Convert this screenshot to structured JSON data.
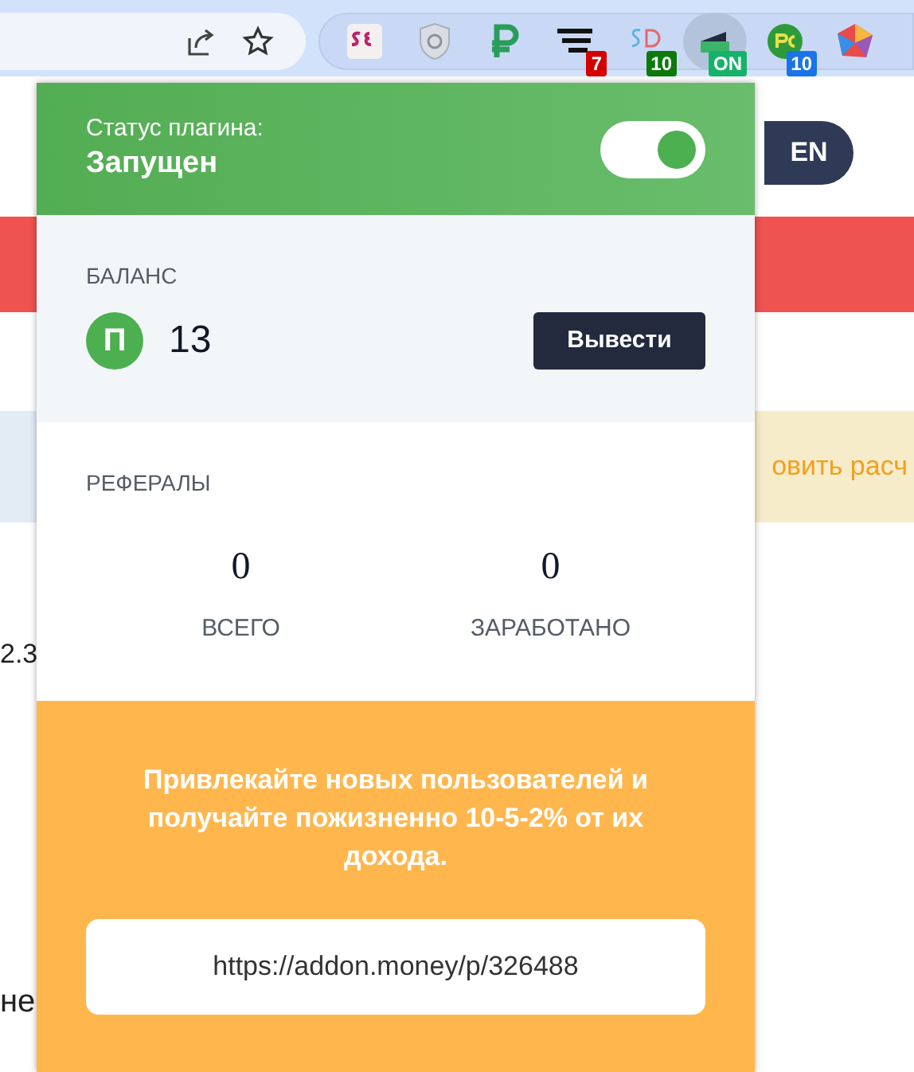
{
  "toolbar": {
    "extensions": [
      {
        "kind": "se",
        "selected": false
      },
      {
        "kind": "shield",
        "selected": false
      },
      {
        "kind": "ruble",
        "selected": false
      },
      {
        "kind": "lines",
        "badge": {
          "text": "7",
          "color": "#d50000"
        },
        "selected": false
      },
      {
        "kind": "sd",
        "badge": {
          "text": "10",
          "color": "#0b7a0b"
        },
        "selected": false
      },
      {
        "kind": "addon",
        "badge": {
          "text": "ON",
          "color": "#17b26a"
        },
        "selected": true
      },
      {
        "kind": "pc",
        "badge": {
          "text": "10",
          "color": "#1a73e8"
        },
        "selected": false
      },
      {
        "kind": "cube",
        "selected": false
      }
    ]
  },
  "background_page": {
    "language_button": "EN",
    "banner_text": "овить расч",
    "left_fragments": [
      "2.3",
      "не"
    ]
  },
  "popup": {
    "status_label": "Статус плагина:",
    "status_value": "Запущен",
    "enabled": true,
    "balance": {
      "title": "БАЛАНС",
      "currency_symbol": "П",
      "amount": "13",
      "withdraw_button": "Вывести"
    },
    "referrals": {
      "title": "РЕФЕРАЛЫ",
      "stats": [
        {
          "value": "0",
          "label": "ВСЕГО"
        },
        {
          "value": "0",
          "label": "ЗАРАБОТАНО"
        }
      ]
    },
    "promo": {
      "text": "Привлекайте новых пользователей и получайте пожизненно 10-5-2% от их дохода.",
      "link": "https://addon.money/p/326488"
    }
  }
}
